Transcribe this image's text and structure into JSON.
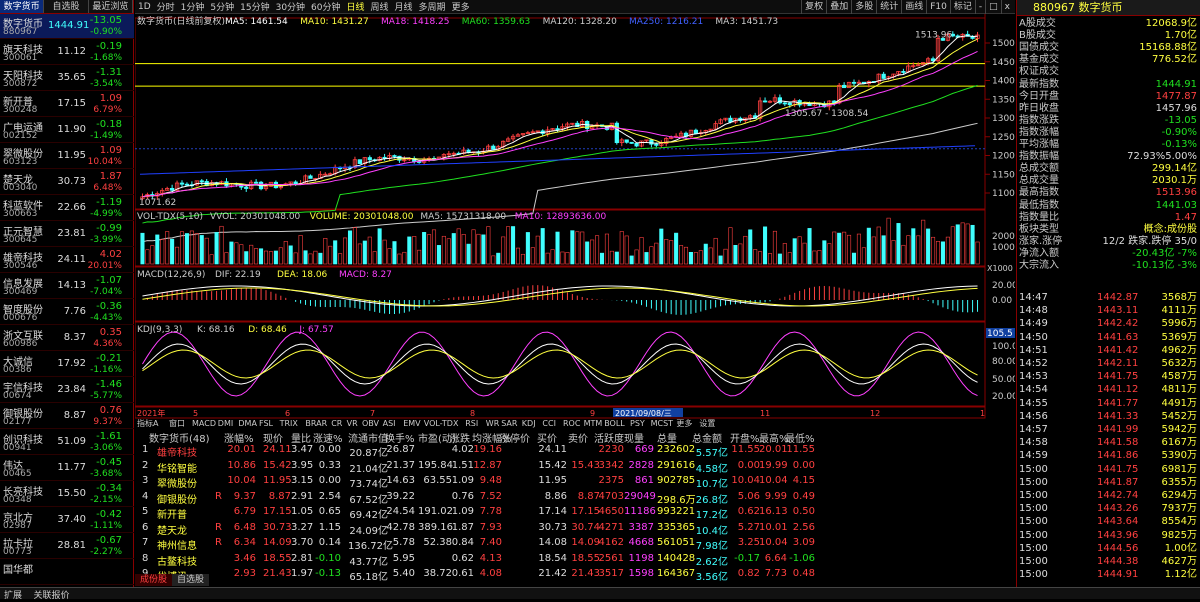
{
  "left": {
    "tabs": [
      "数字货币",
      "自选股",
      "最近浏览"
    ],
    "items": [
      {
        "name": "数字货币",
        "code": "880967",
        "price": "1444.91",
        "chg": "-13.05",
        "pct": "-0.90%",
        "cls": "dn"
      },
      {
        "name": "旗天科技",
        "code": "300061",
        "price": "11.12",
        "chg": "-0.19",
        "pct": "-1.68%",
        "cls": "dn"
      },
      {
        "name": "天阳科技",
        "code": "300872",
        "price": "35.65",
        "chg": "-1.31",
        "pct": "-3.54%",
        "cls": "dn"
      },
      {
        "name": "新开普",
        "code": "300248",
        "price": "17.15",
        "chg": "1.09",
        "pct": "6.79%",
        "cls": "up"
      },
      {
        "name": "广电运通",
        "code": "002152",
        "price": "11.90",
        "chg": "-0.18",
        "pct": "-1.49%",
        "cls": "dn"
      },
      {
        "name": "翠微股份",
        "code": "603123",
        "price": "11.95",
        "chg": "1.09",
        "pct": "10.04%",
        "cls": "up"
      },
      {
        "name": "楚天龙",
        "code": "003040",
        "price": "30.73",
        "chg": "1.87",
        "pct": "6.48%",
        "cls": "up"
      },
      {
        "name": "科蓝软件",
        "code": "300663",
        "price": "22.66",
        "chg": "-1.19",
        "pct": "-4.99%",
        "cls": "dn"
      },
      {
        "name": "正元智慧",
        "code": "300645",
        "price": "23.81",
        "chg": "-0.99",
        "pct": "-3.99%",
        "cls": "dn"
      },
      {
        "name": "雄帝科技",
        "code": "300546",
        "price": "24.11",
        "chg": "4.02",
        "pct": "20.01%",
        "cls": "up"
      },
      {
        "name": "信息发展",
        "code": "300469",
        "price": "14.13",
        "chg": "-1.07",
        "pct": "-7.04%",
        "cls": "dn"
      },
      {
        "name": "智度股份",
        "code": "000676",
        "price": "7.76",
        "chg": "-0.36",
        "pct": "-4.43%",
        "cls": "dn"
      },
      {
        "name": "浙文互联",
        "code": "600986",
        "price": "8.37",
        "chg": "0.35",
        "pct": "4.36%",
        "cls": "up"
      },
      {
        "name": "大诚信",
        "code": "00386",
        "price": "17.92",
        "chg": "-0.21",
        "pct": "-1.16%",
        "cls": "dn"
      },
      {
        "name": "宇信科技",
        "code": "00674",
        "price": "23.84",
        "chg": "-1.46",
        "pct": "-5.77%",
        "cls": "dn"
      },
      {
        "name": "御银股份",
        "code": "02177",
        "price": "8.87",
        "chg": "0.76",
        "pct": "9.37%",
        "cls": "up"
      },
      {
        "name": "创识科技",
        "code": "00941",
        "price": "51.09",
        "chg": "-1.61",
        "pct": "-3.06%",
        "cls": "dn"
      },
      {
        "name": "伟达",
        "code": "00465",
        "price": "11.77",
        "chg": "-0.45",
        "pct": "-3.68%",
        "cls": "dn"
      },
      {
        "name": "长亮科技",
        "code": "00348",
        "price": "15.50",
        "chg": "-0.34",
        "pct": "-2.15%",
        "cls": "dn"
      },
      {
        "name": "京北方",
        "code": "02987",
        "price": "37.40",
        "chg": "-0.42",
        "pct": "-1.11%",
        "cls": "dn"
      },
      {
        "name": "拉卡拉",
        "code": "00773",
        "price": "28.81",
        "chg": "-0.67",
        "pct": "-2.27%",
        "cls": "dn"
      },
      {
        "name": "国华都",
        "code": "",
        "price": "",
        "chg": "",
        "pct": "",
        "cls": "dn"
      }
    ]
  },
  "toolbar": {
    "items": [
      "1D",
      "分时",
      "1分钟",
      "5分钟",
      "15分钟",
      "30分钟",
      "60分钟",
      "日线",
      "周线",
      "月线",
      "多周期",
      "更多"
    ],
    "active": "日线",
    "right": [
      "复权",
      "叠加",
      "多股",
      "统计",
      "画线",
      "F10",
      "标记",
      "-",
      "□",
      "x"
    ]
  },
  "main": {
    "title": "数字货币(日线前复权)",
    "ma": [
      {
        "label": "MA5: 1461.54",
        "color": "#ffffff"
      },
      {
        "label": "MA10: 1431.27",
        "color": "#ffff40"
      },
      {
        "label": "MA18: 1418.25",
        "color": "#ff40ff"
      },
      {
        "label": "MA60: 1359.63",
        "color": "#20e020"
      },
      {
        "label": "MA120: 1328.20",
        "color": "#cccccc"
      },
      {
        "label": "MA250: 1216.21",
        "color": "#4060ff"
      },
      {
        "label": "MA3: 1451.73",
        "color": "#cccccc"
      }
    ],
    "high_label": "1513.96",
    "low_label": "1071.62",
    "mid_label": "1305.67 - 1308.54",
    "yticks": [
      "1500",
      "1450",
      "1400",
      "1350",
      "1300",
      "1250",
      "1200",
      "1150",
      "1100"
    ],
    "vol_title": "VOL-TDX(5,10)",
    "vol_vals": [
      "VVOL: 20301048.00",
      "VOLUME: 20301048.00",
      "MA5: 15731318.00",
      "MA10: 12893636.00"
    ],
    "vol_ticks": [
      "20000",
      "10000"
    ],
    "vol_unit": "X1000",
    "macd_title": "MACD(12,26,9)",
    "macd_vals": [
      "DIF: 22.19",
      "DEA: 18.06",
      "MACD: 8.27"
    ],
    "macd_ticks": [
      "20.00",
      "0.00"
    ],
    "kdj_title": "KDJ(9,3,3)",
    "kdj_vals": [
      "K: 68.16",
      "D: 68.46",
      "J: 67.57"
    ],
    "kdj_ticks": [
      "105.5",
      "100.00",
      "80.00",
      "50.00",
      "20.00"
    ],
    "date_labels": [
      "2021年",
      "5",
      "6",
      "7",
      "8",
      "9",
      "2021/09/08/三",
      "11",
      "12",
      "1"
    ]
  },
  "table_tabs": [
    "指标A",
    "窗口",
    "MACD",
    "DMI",
    "DMA",
    "FSL",
    "TRIX",
    "BRAR",
    "CR",
    "VR",
    "OBV",
    "ASI",
    "EMV",
    "VOL-TDX",
    "RSI",
    "WR",
    "SAR",
    "KDJ",
    "CCI",
    "ROC",
    "MTM",
    "BOLL",
    "PSY",
    "MCST",
    "更多",
    "设置"
  ],
  "table": {
    "headers": [
      "数字货币(48)",
      "涨幅%",
      "现价",
      "量比",
      "涨速%",
      "流通市值",
      "换手%",
      "市盈(动)",
      "涨跌",
      "均涨幅%",
      "涨停价",
      "买价",
      "卖价",
      "活跃度",
      "现量",
      "总量",
      "总金额",
      "开盘%",
      "最高%",
      "最低%"
    ],
    "rows": [
      [
        "1",
        "雄帝科技",
        "20.01",
        "24.11",
        "3.47",
        "0.00",
        "20.87亿",
        "26.87",
        "",
        "4.02",
        "19.16",
        "",
        "24.11",
        "",
        "2230",
        "669",
        "232602",
        "5.57亿",
        "11.55",
        "20.01",
        "11.55"
      ],
      [
        "2",
        "华铭智能",
        "10.86",
        "15.42",
        "3.95",
        "0.33",
        "21.04亿",
        "21.37",
        "195.84",
        "1.51",
        "12.87",
        "",
        "15.42",
        "15.43",
        "3342",
        "2828",
        "291616",
        "4.58亿",
        "0.00",
        "19.99",
        "0.00"
      ],
      [
        "3",
        "翠微股份",
        "10.04",
        "11.95",
        "3.15",
        "0.00",
        "73.74亿",
        "14.63",
        "63.55",
        "1.09",
        "9.48",
        "",
        "11.95",
        "",
        "2375",
        "861",
        "902785",
        "10.7亿",
        "10.04",
        "10.04",
        "4.15"
      ],
      [
        "4",
        "御银股份",
        "9.37",
        "8.87",
        "2.91",
        "2.54",
        "67.52亿",
        "39.22",
        "",
        "0.76",
        "7.52",
        "",
        "8.86",
        "8.87",
        "4703",
        "29049",
        "298.6万",
        "26.8亿",
        "5.06",
        "9.99",
        "0.49"
      ],
      [
        "5",
        "新开普",
        "6.79",
        "17.15",
        "1.05",
        "0.65",
        "69.42亿",
        "24.54",
        "191.02",
        "1.09",
        "7.78",
        "",
        "17.14",
        "17.15",
        "4650",
        "11186",
        "993221",
        "17.2亿",
        "0.62",
        "16.13",
        "0.50"
      ],
      [
        "6",
        "楚天龙",
        "6.48",
        "30.73",
        "3.27",
        "1.15",
        "24.09亿",
        "42.78",
        "389.16",
        "1.87",
        "7.93",
        "",
        "30.73",
        "30.74",
        "4271",
        "3387",
        "335365",
        "10.4亿",
        "5.27",
        "10.01",
        "2.56"
      ],
      [
        "7",
        "神州信息",
        "6.34",
        "14.09",
        "3.70",
        "0.14",
        "136.72亿",
        "5.78",
        "52.38",
        "0.84",
        "7.40",
        "",
        "14.08",
        "14.09",
        "4162",
        "4668",
        "561051",
        "7.98亿",
        "3.25",
        "10.04",
        "3.09"
      ],
      [
        "8",
        "古鳌科技",
        "3.46",
        "18.55",
        "2.81",
        "-0.10",
        "43.77亿",
        "5.95",
        "",
        "0.62",
        "4.13",
        "",
        "18.54",
        "18.55",
        "2561",
        "1198",
        "140428",
        "2.62亿",
        "-0.17",
        "6.64",
        "-1.06"
      ],
      [
        "9",
        "优博讯",
        "2.93",
        "21.43",
        "1.97",
        "-0.13",
        "65.18亿",
        "5.40",
        "38.72",
        "0.61",
        "4.08",
        "",
        "21.42",
        "21.43",
        "3517",
        "1598",
        "164367",
        "3.56亿",
        "0.82",
        "7.73",
        "0.48"
      ]
    ]
  },
  "sheet_tabs": [
    "成份股",
    "自选股"
  ],
  "bottom": [
    "扩展",
    "关联报价"
  ],
  "right": {
    "title": "880967 数字货币",
    "rows": [
      {
        "k": "A股成交",
        "v": "12068.9亿",
        "c": "ye"
      },
      {
        "k": "B股成交",
        "v": "1.70亿",
        "c": "ye"
      },
      {
        "k": "国债成交",
        "v": "15168.88亿",
        "c": "ye"
      },
      {
        "k": "基金成交",
        "v": "776.52亿",
        "c": "ye"
      },
      {
        "k": "权证成交",
        "v": "",
        "c": "ye"
      },
      {
        "k": "最新指数",
        "v": "1444.91",
        "c": "dn"
      },
      {
        "k": "今日开盘",
        "v": "1477.87",
        "c": "up"
      },
      {
        "k": "昨日收盘",
        "v": "1457.96",
        "c": "fl"
      },
      {
        "k": "指数涨跌",
        "v": "-13.05",
        "c": "dn"
      },
      {
        "k": "指数涨幅",
        "v": "-0.90%",
        "c": "dn"
      },
      {
        "k": "平均涨幅",
        "v": "-0.13%",
        "c": "dn"
      },
      {
        "k": "指数振幅",
        "v": "72.93%5.00%",
        "c": "fl"
      },
      {
        "k": "总成交额",
        "v": "299.14亿",
        "c": "ye"
      },
      {
        "k": "总成交量",
        "v": "2030.1万",
        "c": "ye"
      },
      {
        "k": "最高指数",
        "v": "1513.96",
        "c": "up"
      },
      {
        "k": "最低指数",
        "v": "1441.03",
        "c": "dn"
      },
      {
        "k": "指数量比",
        "v": "1.47",
        "c": "up"
      },
      {
        "k": "板块类型",
        "v": "概念:成份股",
        "c": "ye"
      },
      {
        "k": "涨家.涨停",
        "v": "12/2 跌家.跌停 35/0",
        "c": "fl"
      },
      {
        "k": "净流入额",
        "v": "-20.43亿  -7%",
        "c": "dn"
      },
      {
        "k": "大宗流入",
        "v": "-10.13亿  -3%",
        "c": "dn"
      }
    ],
    "ticks": [
      [
        "14:47",
        "1442.87",
        "3568万"
      ],
      [
        "14:48",
        "1443.11",
        "4111万"
      ],
      [
        "14:49",
        "1442.42",
        "5996万"
      ],
      [
        "14:50",
        "1441.63",
        "5369万"
      ],
      [
        "14:51",
        "1441.42",
        "4962万"
      ],
      [
        "14:52",
        "1442.11",
        "5632万"
      ],
      [
        "14:53",
        "1441.75",
        "4587万"
      ],
      [
        "14:54",
        "1441.12",
        "4811万"
      ],
      [
        "14:55",
        "1441.77",
        "4491万"
      ],
      [
        "14:56",
        "1441.33",
        "5452万"
      ],
      [
        "14:57",
        "1441.99",
        "5942万"
      ],
      [
        "14:58",
        "1441.58",
        "6167万"
      ],
      [
        "14:59",
        "1441.86",
        "5390万"
      ],
      [
        "15:00",
        "1441.75",
        "6981万"
      ],
      [
        "15:00",
        "1441.87",
        "6355万"
      ],
      [
        "15:00",
        "1442.74",
        "6294万"
      ],
      [
        "15:00",
        "1443.26",
        "7937万"
      ],
      [
        "15:00",
        "1443.64",
        "8554万"
      ],
      [
        "15:00",
        "1443.96",
        "9825万"
      ],
      [
        "15:00",
        "1444.56",
        "1.00亿"
      ],
      [
        "15:00",
        "1444.38",
        "4627万"
      ],
      [
        "15:00",
        "1444.91",
        "1.12亿"
      ]
    ]
  }
}
